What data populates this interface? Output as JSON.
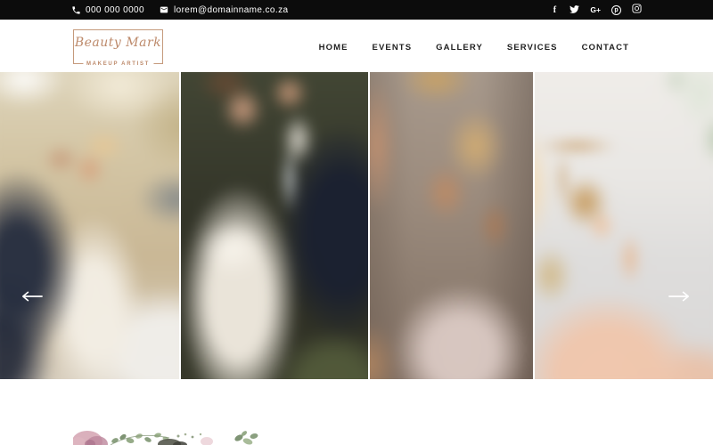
{
  "topbar": {
    "phone": "000 000 0000",
    "email": "lorem@domainname.co.za",
    "social": [
      {
        "name": "facebook",
        "glyph": "f"
      },
      {
        "name": "twitter"
      },
      {
        "name": "google-plus",
        "glyph": "G+"
      },
      {
        "name": "pinterest",
        "glyph": "p"
      },
      {
        "name": "instagram"
      }
    ]
  },
  "brand": {
    "name": "Beauty Mark",
    "tagline": "MAKEUP ARTIST"
  },
  "nav": {
    "items": [
      "HOME",
      "EVENTS",
      "GALLERY",
      "SERVICES",
      "CONTACT"
    ]
  },
  "slider": {
    "prev_label": "Previous slide",
    "next_label": "Next slide",
    "slides": [
      {
        "alt": "Groom in navy suit kissing bride in white lace dress leaning on a white car in a sunlit garden"
      },
      {
        "alt": "Bride with braided updo and bow-back white dress embracing groom in navy suit against dark foliage"
      },
      {
        "alt": "Moody portrait of a blonde woman holding her hair with one hand at her cheek"
      },
      {
        "alt": "Model in a blush gold-embroidered gown seated on the white floor of a bright studio"
      }
    ]
  },
  "colors": {
    "accent": "#bd8a6b",
    "topbar_bg": "#0c0c0c",
    "nav_text": "#1f1f1f"
  }
}
